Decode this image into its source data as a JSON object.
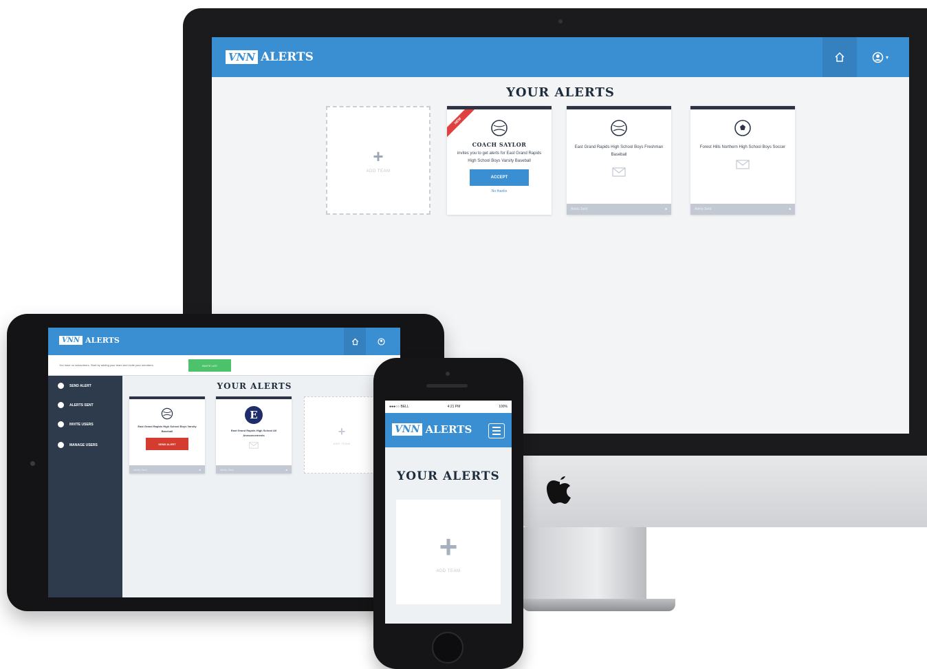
{
  "brand": {
    "logo_mark": "VNN",
    "logo_text": "ALERTS",
    "primary_color": "#3a8fd3",
    "dark_color": "#2c3446",
    "danger_color": "#e04040",
    "success_color": "#4cc36a"
  },
  "desktop": {
    "title": "YOUR ALERTS",
    "nav": {
      "home_icon": "home-icon",
      "account_icon": "user-circle-icon",
      "account_caret": "▾"
    },
    "add_card": {
      "label": "ADD TEAM"
    },
    "cards": [
      {
        "badge": "NEW",
        "icon": "baseball-icon",
        "title": "COACH SAYLOR",
        "text": "invites you to get alerts for East Grand Rapids High School Boys Varsity Baseball",
        "button": "ACCEPT",
        "link": "No thanks"
      },
      {
        "icon": "baseball-icon",
        "text": "East Grand Rapids High School Boys Freshman Baseball",
        "mail_icon": "mail-icon",
        "footer": "Alerts Sent"
      },
      {
        "icon": "soccer-ball-icon",
        "text": "Forest Hills Northern High School Boys Soccer",
        "mail_icon": "mail-icon",
        "footer": "Alerts Sent"
      }
    ]
  },
  "tablet": {
    "title": "YOUR ALERTS",
    "notice": "You have no subscribers. Start by adding your team and invite your members.",
    "notice_button": "INVITE LIST",
    "sidebar": [
      "SEND ALERT",
      "ALERTS SENT",
      "INVITE USERS",
      "MANAGE USERS"
    ],
    "cards": [
      {
        "icon": "baseball-icon",
        "text": "East Grand Rapids High School Boys Varsity Baseball",
        "button": "SEND ALERT",
        "footer": "Alerts Sent"
      },
      {
        "icon": "e-logo-icon",
        "logo_letter": "E",
        "text": "East Grand Rapids High School All Announcements",
        "footer": "Alerts Sent"
      }
    ],
    "add_label": "ADD TEAM"
  },
  "phone": {
    "status": {
      "carrier": "●●●○○ BELL",
      "time": "4:21 PM",
      "battery": "100%"
    },
    "title": "YOUR ALERTS",
    "add_label": "ADD TEAM",
    "menu_icon": "hamburger-menu-icon"
  }
}
